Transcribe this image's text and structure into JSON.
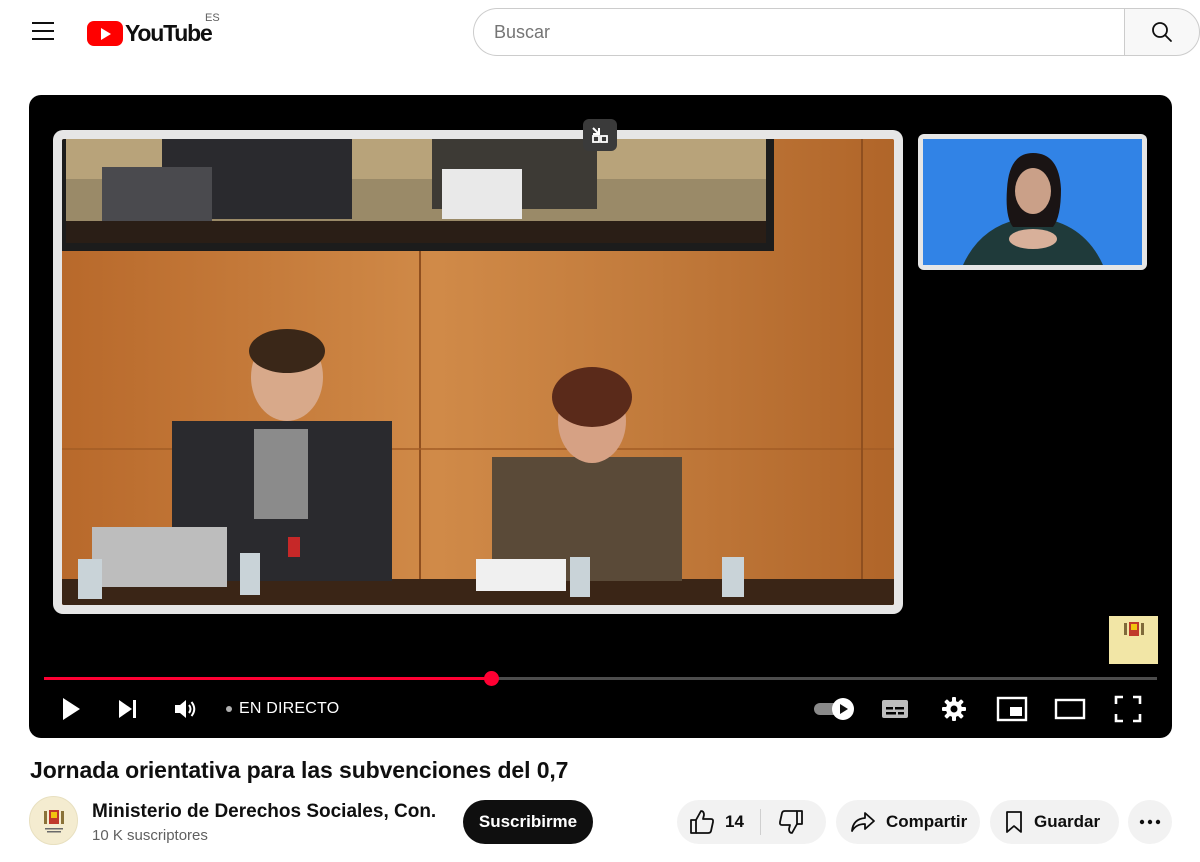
{
  "header": {
    "logo_text": "YouTube",
    "country_code": "ES",
    "search_placeholder": "Buscar"
  },
  "player": {
    "live_label": "EN DIRECTO",
    "progress_fraction": 0.402
  },
  "video": {
    "title": "Jornada orientativa para las subvenciones del 0,7"
  },
  "channel": {
    "name": "Ministerio de Derechos Sociales, Con...",
    "subscribers": "10 K suscriptores",
    "subscribe_label": "Suscribirme"
  },
  "actions": {
    "like_count": "14",
    "share_label": "Compartir",
    "save_label": "Guardar"
  },
  "colors": {
    "brand_red": "#ff0000",
    "progress_red": "#ff0033",
    "subscribe_bg": "#0f0f0f",
    "pill_bg": "#f2f2f2"
  },
  "icons": {
    "menu": "hamburger-menu-icon",
    "search": "search-icon",
    "play": "play-icon",
    "next": "next-icon",
    "volume": "volume-icon",
    "autoplay": "autoplay-toggle-icon",
    "captions": "subtitles-icon",
    "settings": "gear-icon",
    "miniplayer": "miniplayer-icon",
    "theater": "theater-mode-icon",
    "fullscreen": "fullscreen-icon",
    "like": "thumbs-up-icon",
    "dislike": "thumbs-down-icon",
    "share": "share-arrow-icon",
    "save": "bookmark-icon",
    "more": "more-dots-icon"
  }
}
